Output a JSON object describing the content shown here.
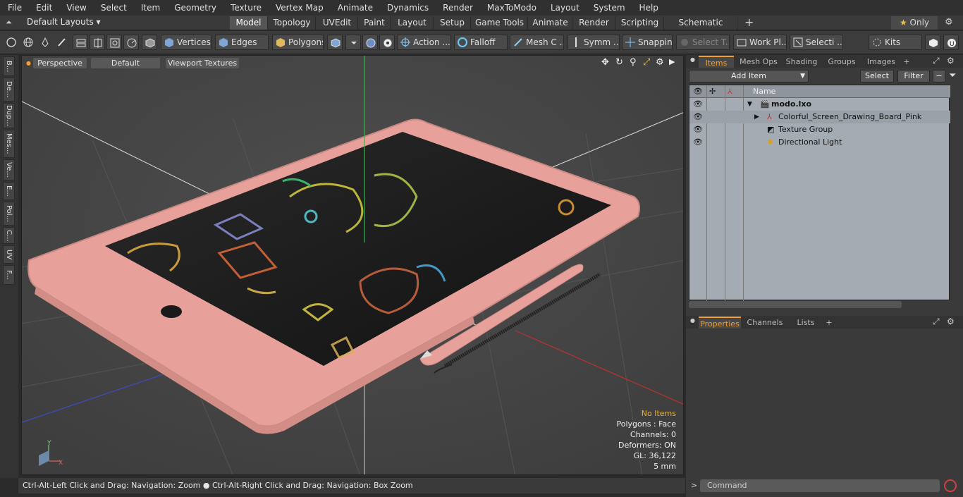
{
  "menu": [
    "File",
    "Edit",
    "View",
    "Select",
    "Item",
    "Geometry",
    "Texture",
    "Vertex Map",
    "Animate",
    "Dynamics",
    "Render",
    "MaxToModo",
    "Layout",
    "System",
    "Help"
  ],
  "layout_selector": "Default Layouts ▾",
  "layout_tabs": [
    "Model",
    "Topology",
    "UVEdit",
    "Paint",
    "Layout",
    "Setup",
    "Game Tools",
    "Animate",
    "Render",
    "Scripting",
    "Schematic Fusion"
  ],
  "only_label": "Only",
  "toolbar": {
    "vertices": "Vertices",
    "edges": "Edges",
    "polygons": "Polygons",
    "action": "Action ...",
    "falloff": "Falloff",
    "mesh": "Mesh C ...",
    "symm": "Symm ...",
    "snapping": "Snapping",
    "select_t": "Select T...",
    "workpl": "Work Pl...",
    "selecti": "Selecti ...",
    "kits": "Kits"
  },
  "left_tabs": [
    "B...",
    "De...",
    "Dup...",
    "Mes...",
    "Ve...",
    "E...",
    "Pol...",
    "C...",
    "UV",
    "F..."
  ],
  "viewport": {
    "perspective": "Perspective",
    "default": "Default",
    "textures": "Viewport Textures",
    "stats": {
      "no_items": "No Items",
      "polygons": "Polygons : Face",
      "channels": "Channels: 0",
      "deformers": "Deformers: ON",
      "gl": "GL: 36,122",
      "scale": "5 mm"
    }
  },
  "status_text": "Ctrl-Alt-Left Click and Drag: Navigation: Zoom ● Ctrl-Alt-Right Click and Drag: Navigation: Box Zoom",
  "items_panel": {
    "tabs": [
      "Items",
      "Mesh Ops",
      "Shading",
      "Groups",
      "Images",
      "+"
    ],
    "add_item": "Add Item",
    "select": "Select",
    "filter": "Filter",
    "col_name": "Name",
    "rows": [
      "modo.lxo",
      "Colorful_Screen_Drawing_Board_Pink",
      "Texture Group",
      "Directional Light"
    ]
  },
  "props_panel": {
    "tabs": [
      "Properties",
      "Channels",
      "Lists",
      "+"
    ]
  },
  "command_placeholder": "Command",
  "colors": {
    "accent": "#f0a030",
    "board": "#e8a09a"
  }
}
